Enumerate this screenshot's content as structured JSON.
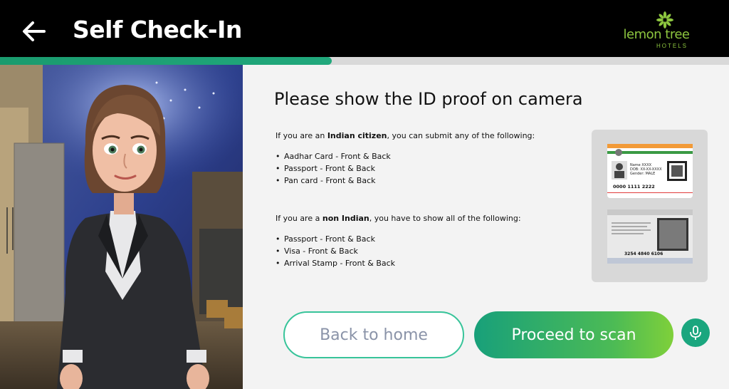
{
  "header": {
    "title": "Self Check-In",
    "back_icon": "arrow-left-icon",
    "logo_text": "lemon tree",
    "logo_sub": "HOTELS",
    "logo_color": "#8dc63f"
  },
  "progress": {
    "percent": 45.5,
    "color": "#1a9b6e"
  },
  "content": {
    "heading": "Please show the ID proof on camera",
    "indian_prefix": "If you are an ",
    "indian_bold": "Indian citizen",
    "indian_suffix": ", you can submit any of the following:",
    "indian_docs": [
      "Aadhar Card - Front & Back",
      "Passport  - Front & Back",
      "Pan card - Front & Back"
    ],
    "foreign_prefix": "If you are a ",
    "foreign_bold": "non Indian",
    "foreign_suffix": ", you have to show all of the following:",
    "foreign_docs": [
      "Passport - Front & Back",
      "Visa  - Front & Back",
      "Arrival Stamp - Front & Back"
    ]
  },
  "card": {
    "front_name": "Name XXXX",
    "front_dob": "DOB: XX-XX-XXXX",
    "front_gender": "Gender: MALE",
    "front_number": "0000 1111 2222",
    "back_number": "3254 4840 6106"
  },
  "buttons": {
    "back_label": "Back to home",
    "proceed_label": "Proceed to scan",
    "mic_icon": "microphone-icon",
    "accent": "#1aa67e"
  }
}
